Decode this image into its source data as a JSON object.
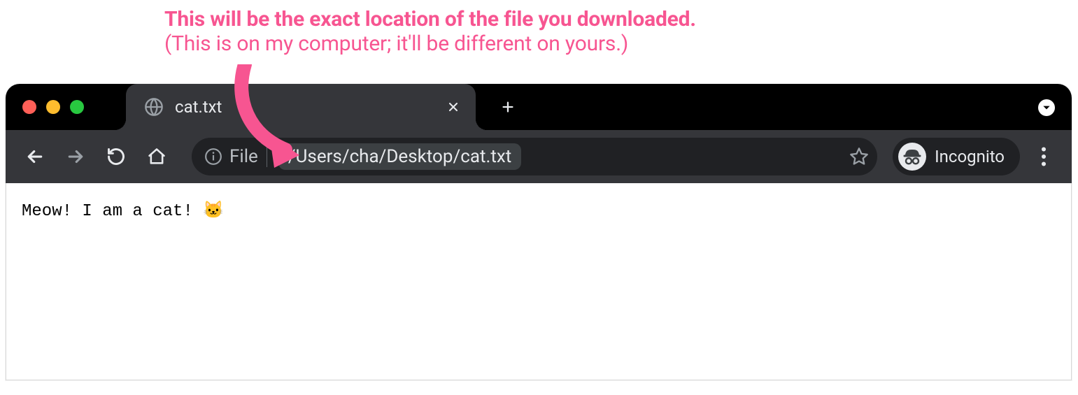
{
  "annotation": {
    "line1": "This will be the exact location of the file you downloaded.",
    "line2": "(This is on my computer; it'll be different on yours.)"
  },
  "colors": {
    "annotation": "#f75591"
  },
  "browser": {
    "tab": {
      "title": "cat.txt"
    },
    "omnibox": {
      "scheme_label": "File",
      "path": "/Users/cha/Desktop/cat.txt"
    },
    "incognito_label": "Incognito",
    "page_content": "Meow! I am a cat! 🐱"
  }
}
